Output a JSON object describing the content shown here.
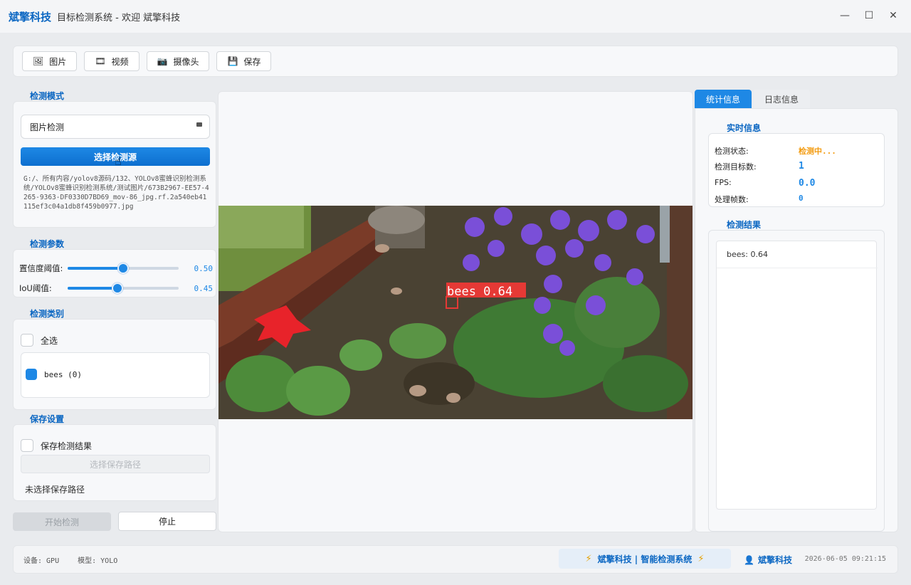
{
  "window": {
    "brand": "斌擎科技",
    "title": "目标检测系统 - 欢迎 斌擎科技",
    "controls": [
      "—",
      "☐",
      "✕"
    ]
  },
  "toolbar": {
    "image": "图片",
    "video": "视频",
    "camera": "摄像头",
    "save": "保存"
  },
  "left": {
    "mode_title": "检测模式",
    "mode_value": "图片检测",
    "select_source": "选择检测源",
    "path": "G:/、所有内容/yolov8源码/132、YOLOv8蜜蜂识别检测系统/YOLOv8蜜蜂识别检测系统/测试图片/673B2967-EE57-4265-9363-DF0330D7BD69_mov-86_jpg.rf.2a540eb41115ef3c04a1db8f459b0977.jpg",
    "params_title": "检测参数",
    "conf_label": "置信度阈值:",
    "conf_value": "0.50",
    "conf": 0.5,
    "iou_label": "IoU阈值:",
    "iou_value": "0.45",
    "iou": 0.45,
    "classes_title": "检测类别",
    "select_all": "全选",
    "class_item": "bees (0)",
    "save_title": "保存设置",
    "save_results": "保存检测结果",
    "select_save_path": "选择保存路径",
    "no_path": "未选择保存路径",
    "start": "开始检测",
    "stop": "停止"
  },
  "detection": {
    "label": "bees 0.64"
  },
  "right": {
    "tab_stats": "统计信息",
    "tab_log": "日志信息",
    "realtime_title": "实时信息",
    "status_key": "检测状态:",
    "status_val": "检测中...",
    "count_key": "检测目标数:",
    "count_val": "1",
    "fps_key": "FPS:",
    "fps_val": "0.0",
    "frames_key": "处理帧数:",
    "frames_val": "0",
    "results_title": "检测结果",
    "result_item": "bees: 0.64"
  },
  "status": {
    "device": "设备: GPU",
    "model": "模型: YOLO",
    "banner": "斌擎科技 | 智能检测系统",
    "user": "斌擎科技",
    "time": "2026-06-05 09:21:15"
  },
  "colors": {
    "accent": "#1e88e5",
    "brand": "#0a66c2",
    "status_warn": "#f39c12",
    "bbox": "#e53935"
  }
}
